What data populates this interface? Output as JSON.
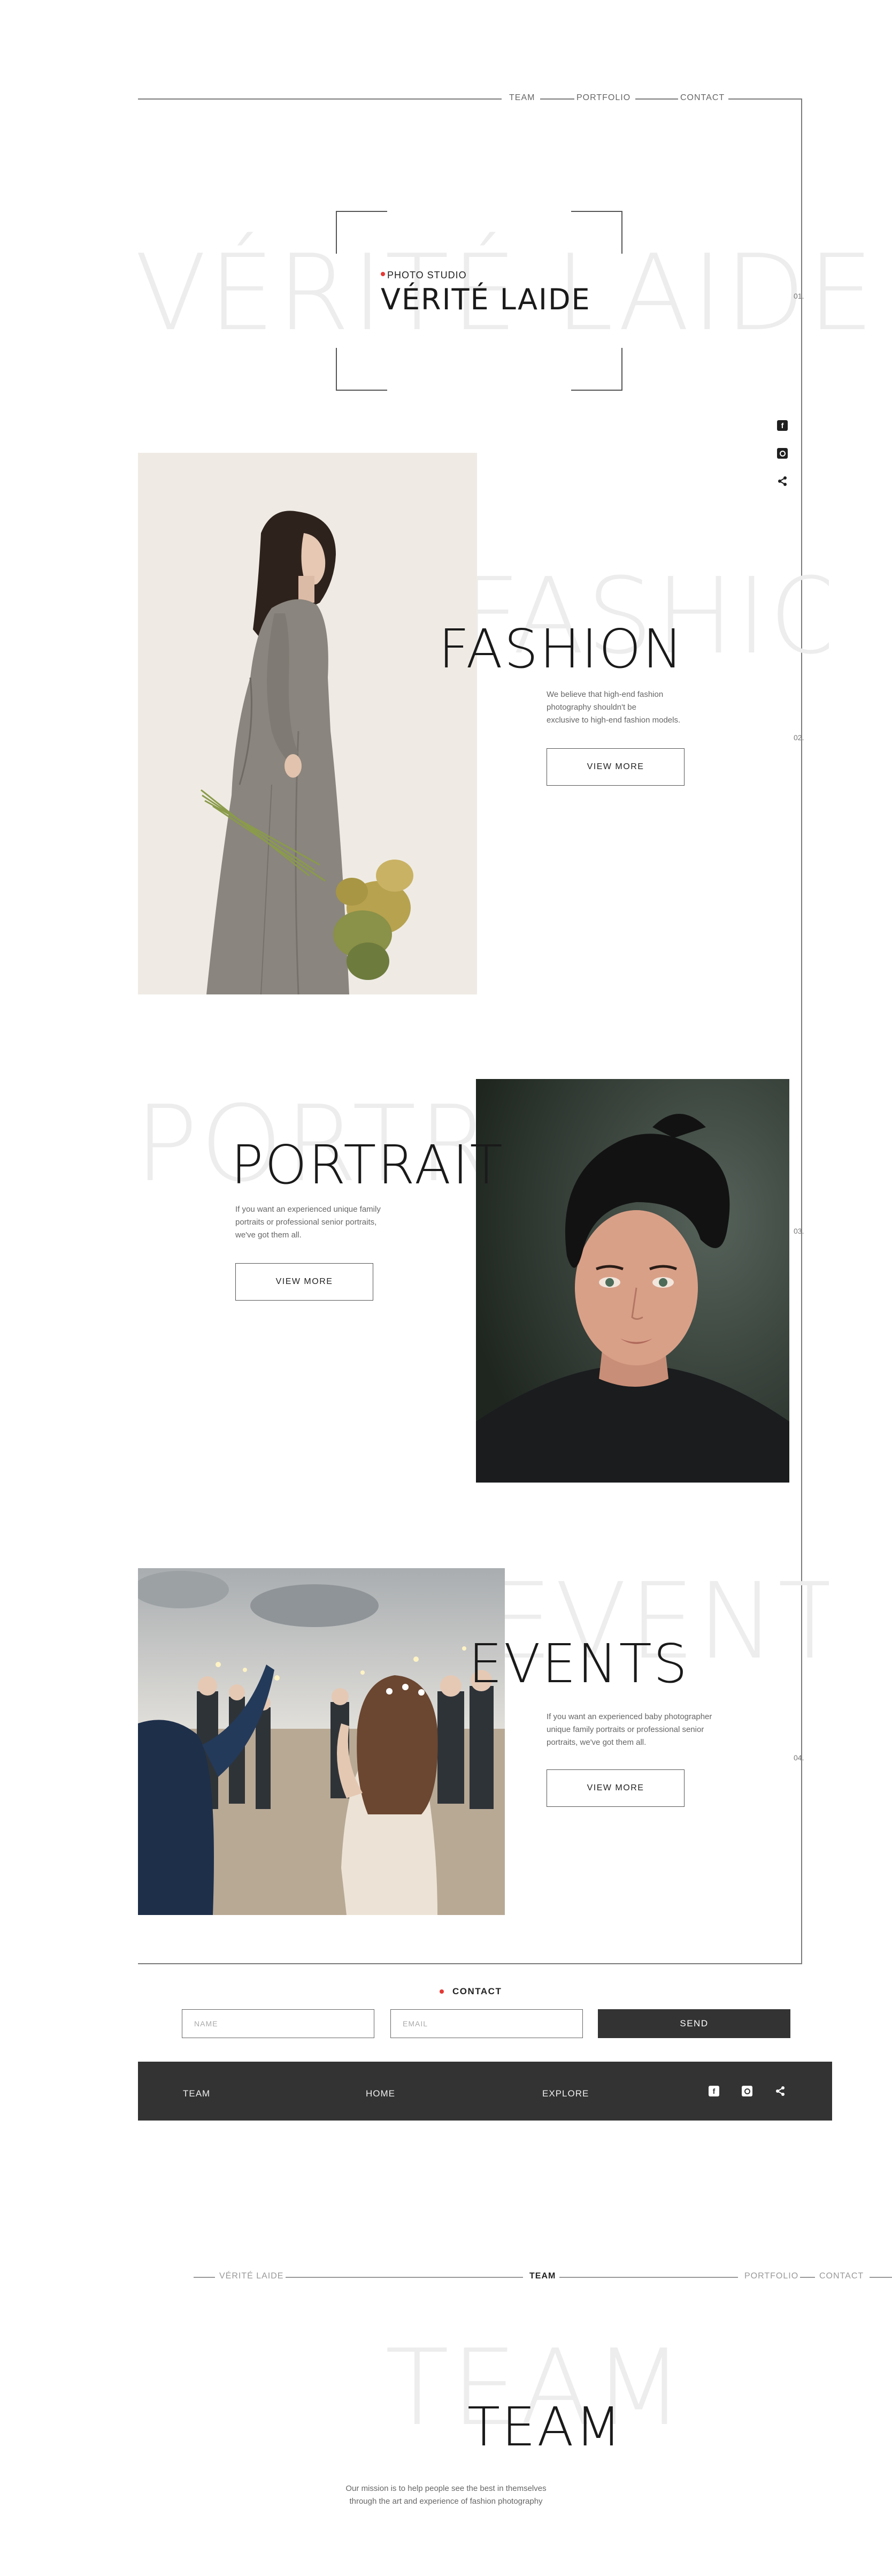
{
  "nav": {
    "team": "TEAM",
    "portfolio": "PORTFOLIO",
    "contact": "CONTACT"
  },
  "hero": {
    "kicker": "PHOTO STUDIO",
    "title": "VÉRITÉ LAIDE",
    "ghost": "VÉRITÉ LAIDE",
    "number": "01."
  },
  "social_icons": [
    "facebook-icon",
    "instagram-icon",
    "share-icon"
  ],
  "fashion": {
    "ghost": "FASHION",
    "title": "FASHION",
    "description": [
      "We believe that high-end fashion",
      "photography shouldn't be",
      "exclusive to high-end fashion models."
    ],
    "button": "VIEW MORE",
    "number": "02."
  },
  "portrait": {
    "ghost": "PORTRAIT",
    "title": "PORTRAIT",
    "description": [
      "If you want an experienced unique family",
      "portraits or professional senior portraits,",
      "we've got them all."
    ],
    "button": "VIEW MORE",
    "number": "03."
  },
  "events": {
    "ghost": "EVENTS",
    "title": "EVENTS",
    "description": [
      "If you want an experienced baby photographer",
      "unique family portraits or professional senior",
      "portraits, we've got them all."
    ],
    "button": "VIEW MORE",
    "number": "04."
  },
  "contact": {
    "heading": "CONTACT",
    "name_placeholder": "NAME",
    "email_placeholder": "EMAIL",
    "send": "SEND",
    "accent": "#e53935"
  },
  "footer": {
    "team": "TEAM",
    "home": "HOME",
    "explore": "EXPLORE",
    "background": "#333333"
  },
  "second_nav": {
    "brand": "VÉRITÉ LAIDE",
    "team": "TEAM",
    "portfolio": "PORTFOLIO",
    "contact": "CONTACT"
  },
  "team": {
    "ghost": "TEAM",
    "title": "TEAM",
    "mission": [
      "Our mission is to help people see the best in themselves",
      "through the art and experience of fashion photography"
    ]
  }
}
